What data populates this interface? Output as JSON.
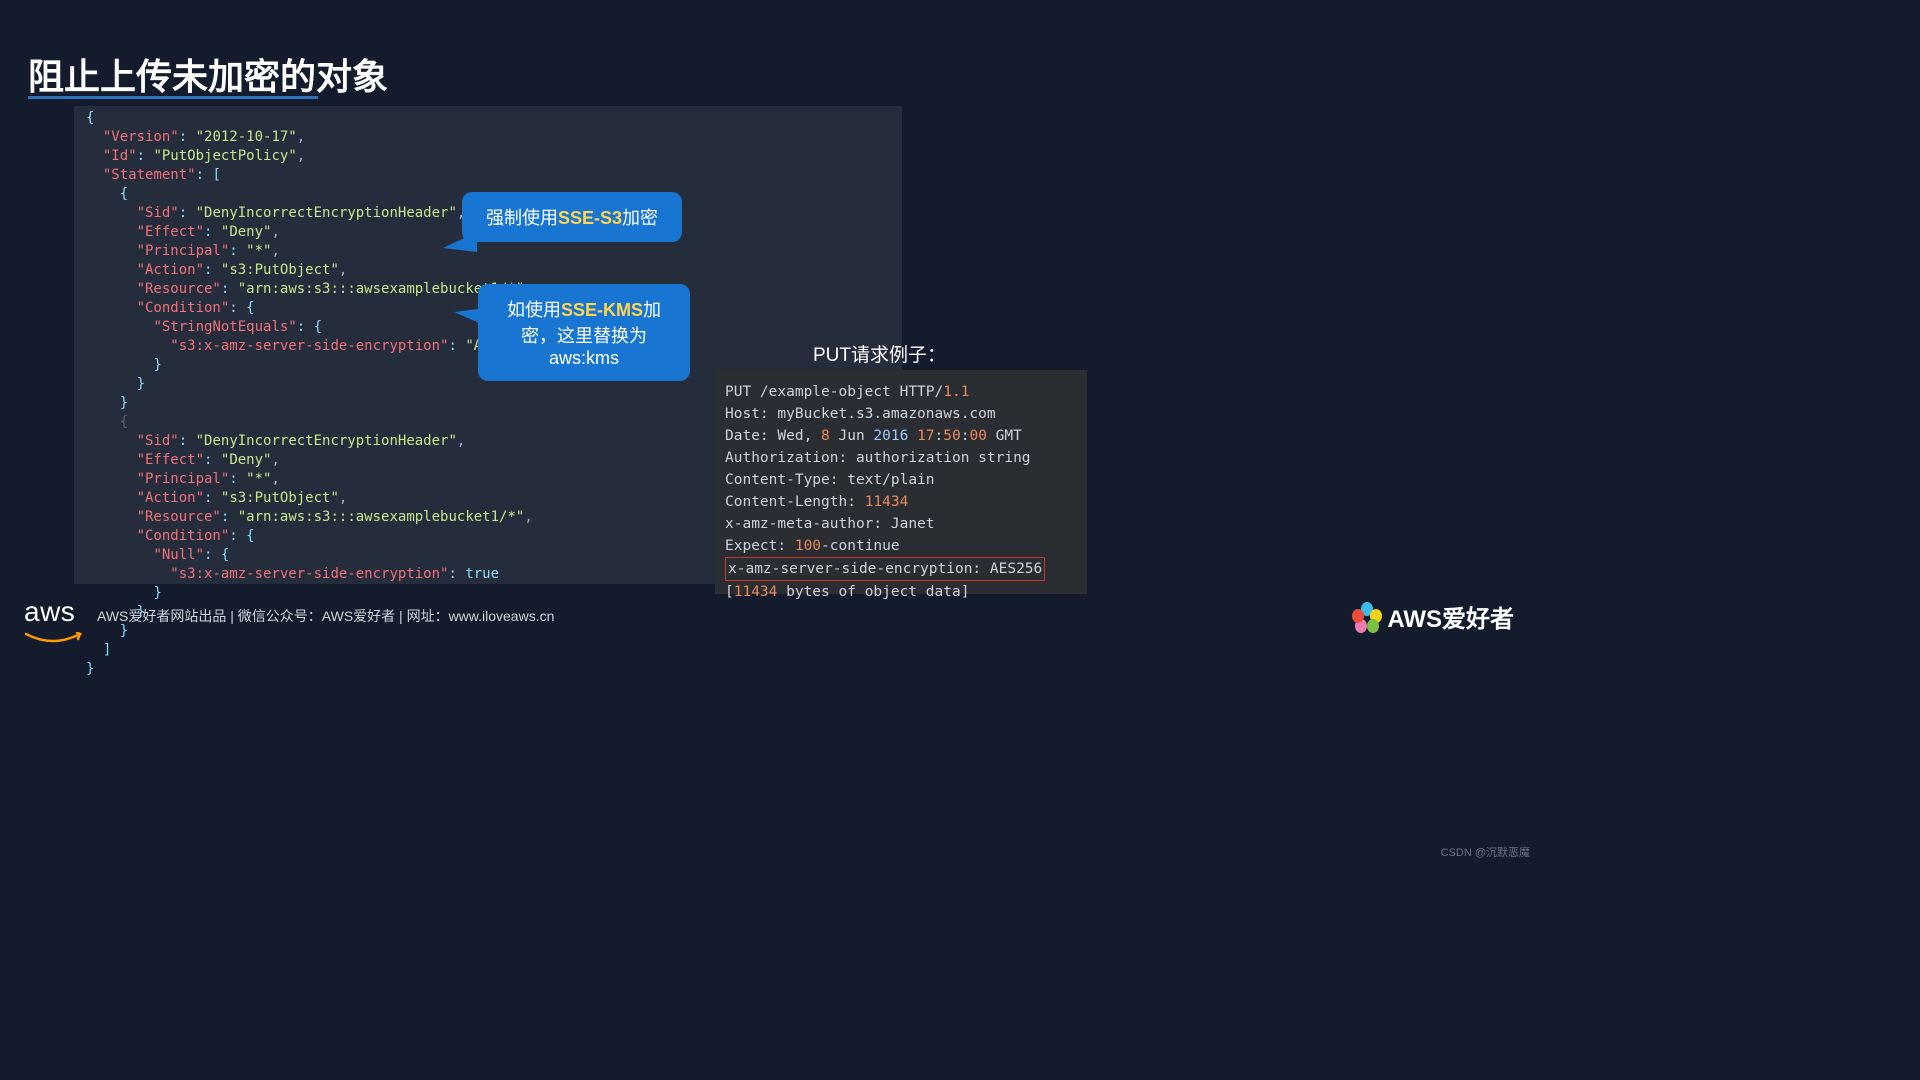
{
  "title": "阻止上传未加密的对象",
  "code_lines": [
    {
      "ind": 0,
      "raw": "{"
    },
    {
      "ind": 1,
      "key": "Version",
      "val": "2012-10-17",
      "comma": true
    },
    {
      "ind": 1,
      "key": "Id",
      "val": "PutObjectPolicy",
      "comma": true
    },
    {
      "ind": 1,
      "key": "Statement",
      "open": "[",
      "comma": false
    },
    {
      "ind": 2,
      "raw": "{"
    },
    {
      "ind": 3,
      "key": "Sid",
      "val": "DenyIncorrectEncryptionHeader",
      "comma": true
    },
    {
      "ind": 3,
      "key": "Effect",
      "val": "Deny",
      "comma": true
    },
    {
      "ind": 3,
      "key": "Principal",
      "val": "*",
      "comma": true
    },
    {
      "ind": 3,
      "key": "Action",
      "val": "s3:PutObject",
      "comma": true
    },
    {
      "ind": 3,
      "key": "Resource",
      "val": "arn:aws:s3:::awsexamplebucket1/*",
      "comma": true
    },
    {
      "ind": 3,
      "key": "Condition",
      "open": "{",
      "comma": false
    },
    {
      "ind": 4,
      "key": "StringNotEquals",
      "open": "{",
      "comma": false
    },
    {
      "ind": 5,
      "key": "s3:x-amz-server-side-encryption",
      "val": "AES256",
      "comma": false
    },
    {
      "ind": 4,
      "raw": "}"
    },
    {
      "ind": 3,
      "raw": "}"
    },
    {
      "ind": 2,
      "raw": "}"
    },
    {
      "ind": 2,
      "raw": "{",
      "sep": true
    },
    {
      "ind": 3,
      "key": "Sid",
      "val": "DenyIncorrectEncryptionHeader",
      "comma": true
    },
    {
      "ind": 3,
      "key": "Effect",
      "val": "Deny",
      "comma": true
    },
    {
      "ind": 3,
      "key": "Principal",
      "val": "*",
      "comma": true
    },
    {
      "ind": 3,
      "key": "Action",
      "val": "s3:PutObject",
      "comma": true
    },
    {
      "ind": 3,
      "key": "Resource",
      "val": "arn:aws:s3:::awsexamplebucket1/*",
      "comma": true
    },
    {
      "ind": 3,
      "key": "Condition",
      "open": "{",
      "comma": false
    },
    {
      "ind": 4,
      "key": "Null",
      "open": "{",
      "comma": false
    },
    {
      "ind": 5,
      "key": "s3:x-amz-server-side-encryption",
      "bool": "true",
      "comma": false
    },
    {
      "ind": 4,
      "raw": "}"
    },
    {
      "ind": 3,
      "raw": "}"
    },
    {
      "ind": 2,
      "raw": "}"
    },
    {
      "ind": 1,
      "raw": "]"
    },
    {
      "ind": 0,
      "raw": "}"
    }
  ],
  "callouts": {
    "c1_pre": "强制使用",
    "c1_hl": "SSE-S3",
    "c1_post": "加密",
    "c2_pre": "如使用",
    "c2_hl": "SSE-KMS",
    "c2_post": "加密，这里替换为 aws:kms"
  },
  "request_label": "PUT请求例子：",
  "request_lines": [
    "PUT /example-object HTTP/1.1",
    "Host: myBucket.s3.amazonaws.com",
    "Date: Wed, 8 Jun 2016 17:50:00 GMT",
    "Authorization: authorization string",
    "Content-Type: text/plain",
    "Content-Length: 11434",
    "x-amz-meta-author: Janet",
    "Expect: 100-continue",
    "x-amz-server-side-encryption: AES256",
    "[11434 bytes of object data]"
  ],
  "request_highlight_index": 8,
  "footer": {
    "logo": "aws",
    "text": "AWS爱好者网站出品 | 微信公众号：AWS爱好者 | 网址：www.iloveaws.cn",
    "brand": "AWS爱好者"
  },
  "watermark": "CSDN @沉默恶魔"
}
